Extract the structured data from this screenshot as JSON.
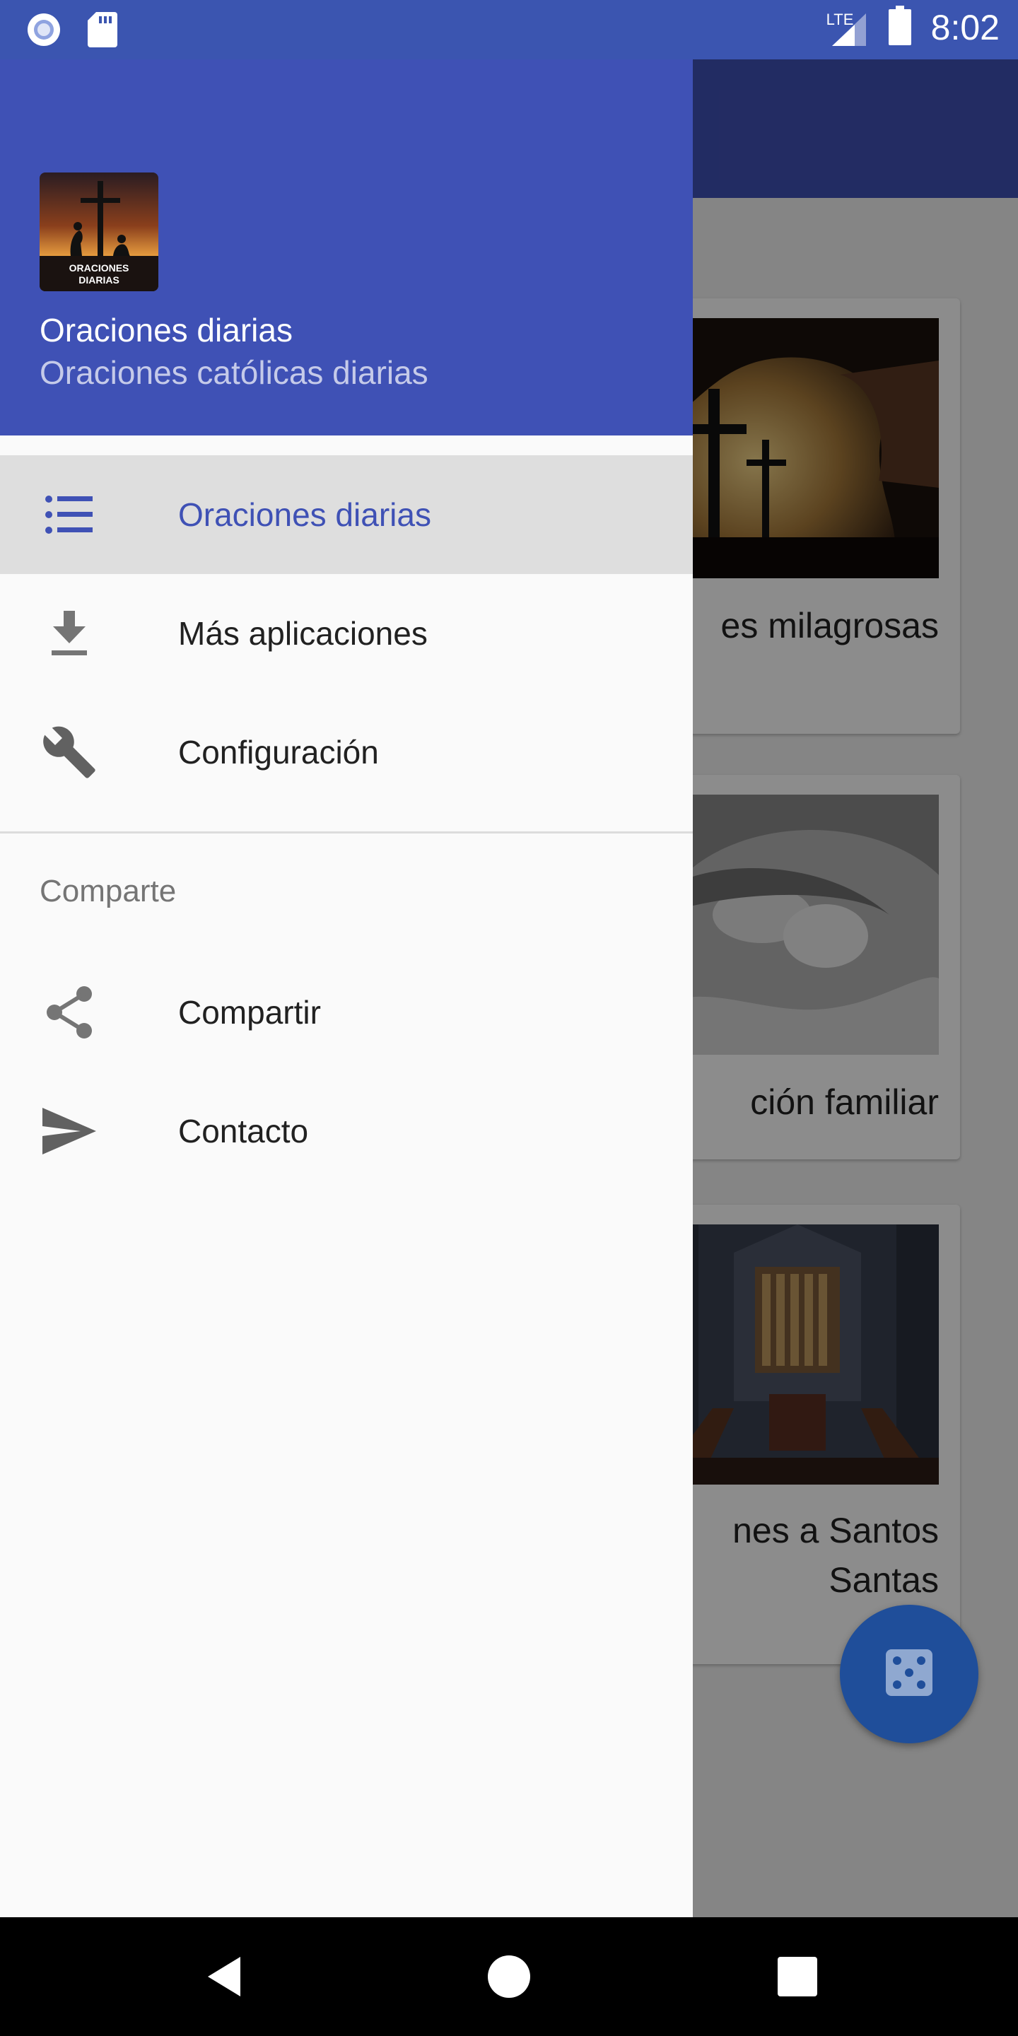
{
  "status_bar": {
    "time": "8:02",
    "network": "LTE",
    "icons": [
      "record-icon",
      "sd-card-icon",
      "signal-icon",
      "battery-icon"
    ]
  },
  "drawer": {
    "header": {
      "logo_text": "ORACIONES\nDIARIAS",
      "title": "Oraciones diarias",
      "subtitle": "Oraciones católicas diarias"
    },
    "items": [
      {
        "label": "Oraciones diarias",
        "icon": "list-icon",
        "active": true
      },
      {
        "label": "Más aplicaciones",
        "icon": "download-icon",
        "active": false
      },
      {
        "label": "Configuración",
        "icon": "wrench-icon",
        "active": false
      }
    ],
    "section_label": "Comparte",
    "share_items": [
      {
        "label": "Compartir",
        "icon": "share-icon"
      },
      {
        "label": "Contacto",
        "icon": "send-icon"
      }
    ]
  },
  "background": {
    "cards": [
      {
        "title": "es milagrosas",
        "image": "crosses-cave"
      },
      {
        "title": "ción familiar",
        "image": "baby-feet-hands"
      },
      {
        "title_line1": "nes a Santos",
        "title_line2": "Santas",
        "image": "cathedral-organ"
      }
    ],
    "fab_icon": "dice-icon"
  },
  "colors": {
    "primary": "#3f51b5",
    "status_bar": "#3b55b0",
    "accent_fab": "#1f4e9a",
    "active_item_bg": "#dedede"
  }
}
